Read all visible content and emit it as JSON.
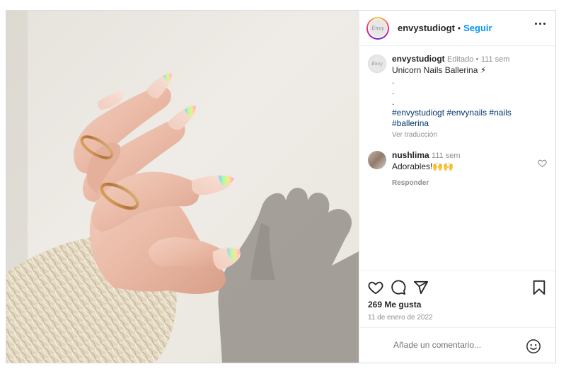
{
  "post": {
    "username": "envystudiogt",
    "separator": "•",
    "follow_label": "Seguir",
    "avatar_text": "Envy"
  },
  "caption": {
    "username": "envystudiogt",
    "edited_label": "Editado",
    "separator": "•",
    "time": "111 sem",
    "text": "Unicorn Nails Ballerina ⚡",
    "dots": [
      ".",
      ".",
      "."
    ],
    "hashtags": "#envystudiogt #envynails #nails #ballerina",
    "translate_label": "Ver traducción"
  },
  "reply_comment": {
    "username": "nushlima",
    "time": "111 sem",
    "text": "Adorables!🙌🙌",
    "reply_label": "Responder"
  },
  "actions": {
    "icons": [
      "heart-icon",
      "comment-icon",
      "share-icon",
      "bookmark-icon"
    ],
    "likes": "269 Me gusta",
    "date": "11 de enero de 2022"
  },
  "composer": {
    "placeholder": "Añade un comentario...",
    "icon": "emoji-icon"
  },
  "colors": {
    "link": "#0095f6",
    "hashtag": "#00376b",
    "muted": "#8e8e8e",
    "text": "#262626",
    "border": "#dbdbdb"
  }
}
